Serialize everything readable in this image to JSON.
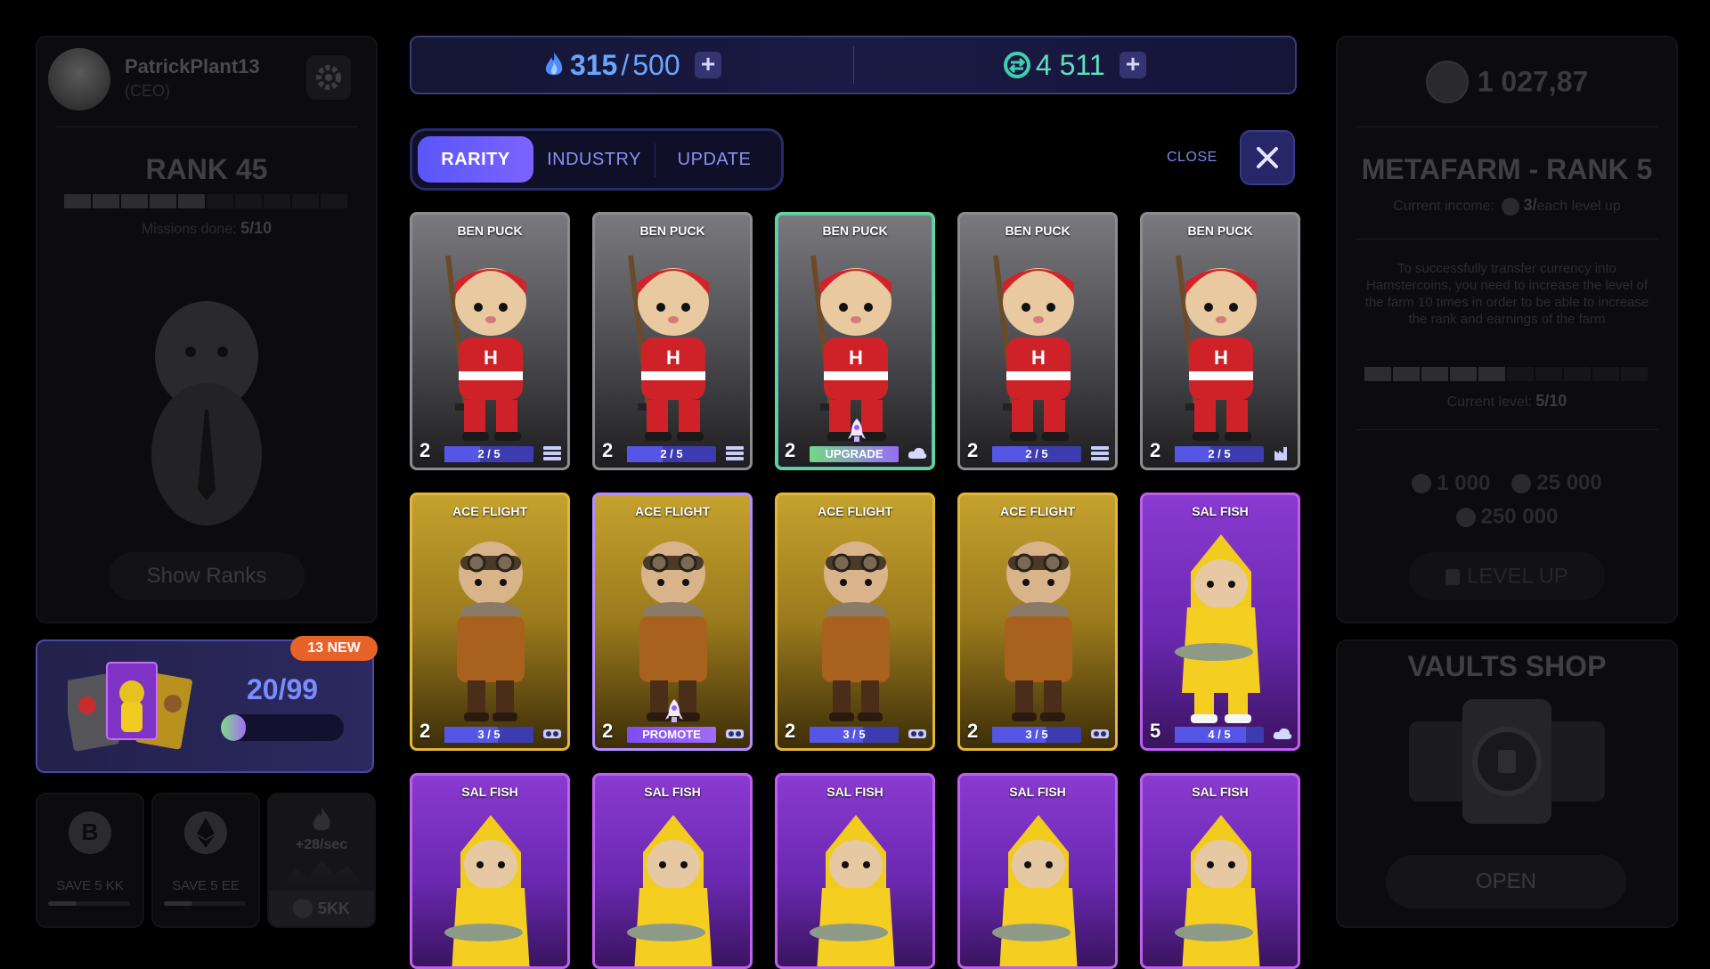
{
  "profile": {
    "username": "PatrickPlant13",
    "role": "(CEO)",
    "rank_title": "RANK 45",
    "missions_label": "Missions done:",
    "missions_value": "5/10",
    "missions_done": 5,
    "missions_total": 10,
    "show_ranks": "Show Ranks"
  },
  "collection": {
    "badge": "13 NEW",
    "count": "20/99",
    "progress_fraction": 0.2
  },
  "savers": [
    {
      "icon": "bitcoin-icon",
      "label": "SAVE 5 KK"
    },
    {
      "icon": "ethereum-icon",
      "label": "SAVE 5 EE"
    },
    {
      "icon": "flame-icon",
      "rate": "+28/sec",
      "price": "5KK"
    }
  ],
  "currency": {
    "energy_current": "315",
    "energy_max": "500",
    "energy_sep": "/",
    "tokens": "4 511"
  },
  "tabs": [
    {
      "label": "RARITY",
      "active": true
    },
    {
      "label": "INDUSTRY",
      "active": false
    },
    {
      "label": "UPDATE",
      "active": false
    }
  ],
  "close_label": "CLOSE",
  "cards_row1": [
    {
      "name": "BEN PUCK",
      "level": "2",
      "progress": "2 / 5",
      "fraction": 0.4,
      "icon": "server-icon",
      "style": "grey"
    },
    {
      "name": "BEN PUCK",
      "level": "2",
      "progress": "2 / 5",
      "fraction": 0.4,
      "icon": "server-icon",
      "style": "grey"
    },
    {
      "name": "BEN PUCK",
      "level": "2",
      "progress": "UPGRADE",
      "fraction": 1,
      "icon": "cloud-icon",
      "style": "grey-sel"
    },
    {
      "name": "BEN PUCK",
      "level": "2",
      "progress": "2 / 5",
      "fraction": 0.4,
      "icon": "server-icon",
      "style": "grey"
    },
    {
      "name": "BEN PUCK",
      "level": "2",
      "progress": "2 / 5",
      "fraction": 0.4,
      "icon": "factory-icon",
      "style": "grey"
    }
  ],
  "cards_row2": [
    {
      "name": "ACE FLIGHT",
      "level": "2",
      "progress": "3 / 5",
      "fraction": 0.6,
      "icon": "vr-icon",
      "style": "gold"
    },
    {
      "name": "ACE FLIGHT",
      "level": "2",
      "progress": "PROMOTE",
      "fraction": 1,
      "icon": "vr-icon",
      "style": "gold-sel"
    },
    {
      "name": "ACE FLIGHT",
      "level": "2",
      "progress": "3 / 5",
      "fraction": 0.6,
      "icon": "vr-icon",
      "style": "gold"
    },
    {
      "name": "ACE FLIGHT",
      "level": "2",
      "progress": "3 / 5",
      "fraction": 0.6,
      "icon": "vr-icon",
      "style": "gold"
    },
    {
      "name": "SAL FISH",
      "level": "5",
      "progress": "4 / 5",
      "fraction": 0.8,
      "icon": "cloud-icon",
      "style": "purple"
    }
  ],
  "cards_row3": [
    {
      "name": "SAL FISH"
    },
    {
      "name": "SAL FISH"
    },
    {
      "name": "SAL FISH"
    },
    {
      "name": "SAL FISH"
    },
    {
      "name": "SAL FISH"
    }
  ],
  "metafarm": {
    "balance": "1 027,87",
    "title": "METAFARM - RANK 5",
    "income_label": "Current income:",
    "income_value": "3/",
    "income_suffix": "each level up",
    "description": "To successfully transfer currency into Hamstercoins, you need to increase the level of the farm 10 times in order to be able to increase the rank and earnings of the farm",
    "level_label": "Current level:",
    "level_value": "5/10",
    "level_done": 5,
    "level_total": 10,
    "cost_btc": "1 000",
    "cost_eth": "25 000",
    "cost_token": "250 000",
    "level_up": "LEVEL UP"
  },
  "vaults": {
    "title": "VAULTS SHOP",
    "open": "OPEN"
  },
  "colors": {
    "accent": "#5a56f8",
    "energy": "#4f8dff",
    "token": "#3fd0b0"
  }
}
